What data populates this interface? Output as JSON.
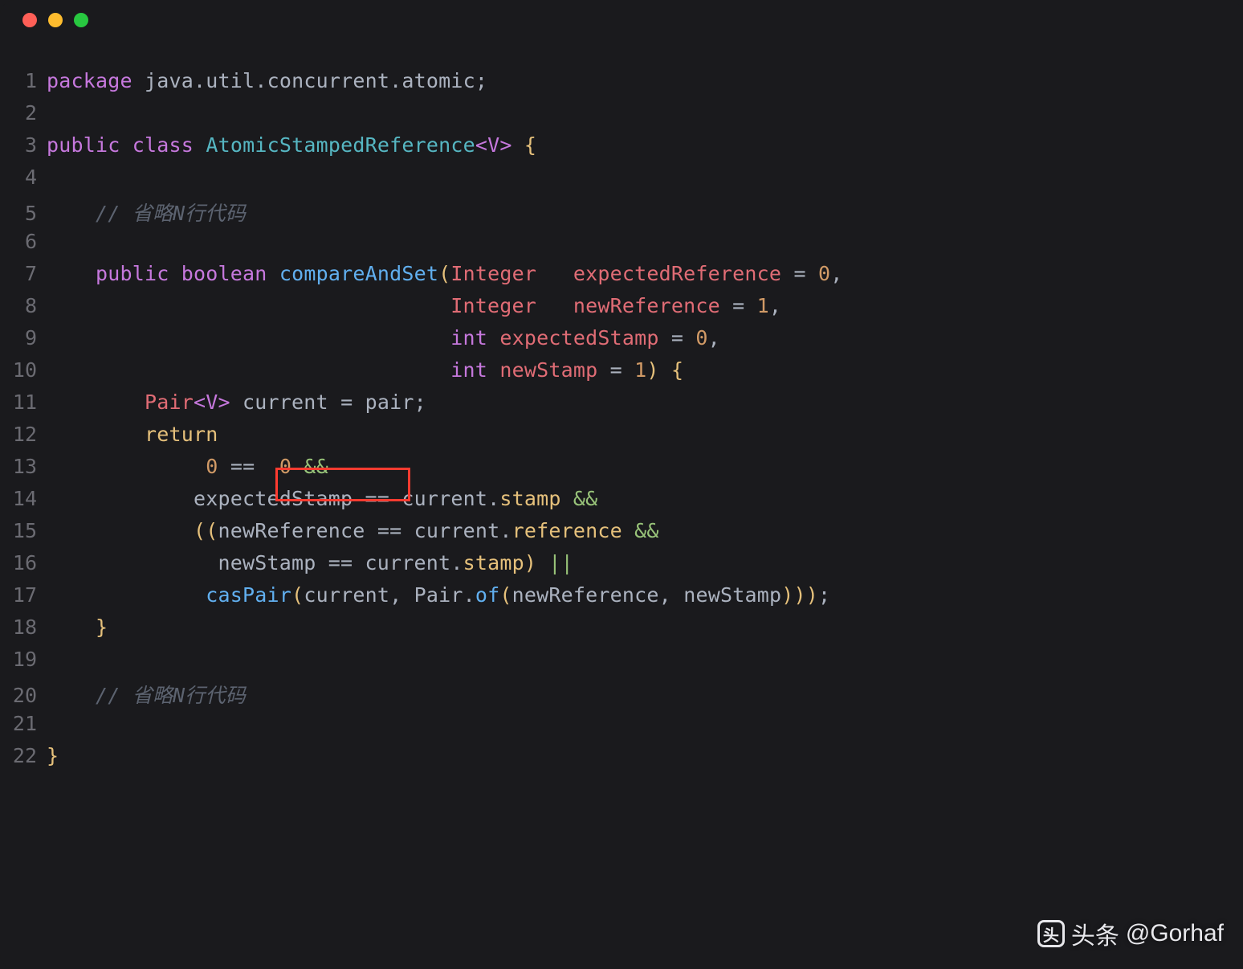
{
  "traffic_lights": {
    "red": "#ff5f57",
    "yellow": "#febc2e",
    "green": "#28c840"
  },
  "highlight": {
    "target": "0 == 0"
  },
  "watermark": {
    "brand": "头条",
    "handle": "@Gorhaf"
  },
  "lines": [
    {
      "n": 1,
      "tokens": [
        [
          "kw",
          "package"
        ],
        [
          "plain",
          " java"
        ],
        [
          "op",
          "."
        ],
        [
          "plain",
          "util"
        ],
        [
          "op",
          "."
        ],
        [
          "plain",
          "concurrent"
        ],
        [
          "op",
          "."
        ],
        [
          "plain",
          "atomic"
        ],
        [
          "op",
          ";"
        ]
      ]
    },
    {
      "n": 2,
      "tokens": []
    },
    {
      "n": 3,
      "tokens": [
        [
          "kw",
          "public"
        ],
        [
          "plain",
          " "
        ],
        [
          "kw",
          "class"
        ],
        [
          "plain",
          " "
        ],
        [
          "classnm",
          "AtomicStampedReference"
        ],
        [
          "generic",
          "<V>"
        ],
        [
          "plain",
          " "
        ],
        [
          "prop",
          "{"
        ]
      ]
    },
    {
      "n": 4,
      "tokens": []
    },
    {
      "n": 5,
      "tokens": [
        [
          "plain",
          "    "
        ],
        [
          "comment",
          "// 省略N行代码"
        ]
      ]
    },
    {
      "n": 6,
      "tokens": []
    },
    {
      "n": 7,
      "tokens": [
        [
          "plain",
          "    "
        ],
        [
          "kw",
          "public"
        ],
        [
          "plain",
          " "
        ],
        [
          "kw",
          "boolean"
        ],
        [
          "plain",
          " "
        ],
        [
          "method",
          "compareAndSet"
        ],
        [
          "prop",
          "("
        ],
        [
          "type",
          "Integer"
        ],
        [
          "plain",
          "   "
        ],
        [
          "param",
          "expectedReference"
        ],
        [
          "plain",
          " "
        ],
        [
          "op",
          "="
        ],
        [
          "plain",
          " "
        ],
        [
          "num",
          "0"
        ],
        [
          "op",
          ","
        ]
      ]
    },
    {
      "n": 8,
      "tokens": [
        [
          "plain",
          "                                 "
        ],
        [
          "type",
          "Integer"
        ],
        [
          "plain",
          "   "
        ],
        [
          "param",
          "newReference"
        ],
        [
          "plain",
          " "
        ],
        [
          "op",
          "="
        ],
        [
          "plain",
          " "
        ],
        [
          "num",
          "1"
        ],
        [
          "op",
          ","
        ]
      ]
    },
    {
      "n": 9,
      "tokens": [
        [
          "plain",
          "                                 "
        ],
        [
          "kw",
          "int"
        ],
        [
          "plain",
          " "
        ],
        [
          "param",
          "expectedStamp"
        ],
        [
          "plain",
          " "
        ],
        [
          "op",
          "="
        ],
        [
          "plain",
          " "
        ],
        [
          "num",
          "0"
        ],
        [
          "op",
          ","
        ]
      ]
    },
    {
      "n": 10,
      "tokens": [
        [
          "plain",
          "                                 "
        ],
        [
          "kw",
          "int"
        ],
        [
          "plain",
          " "
        ],
        [
          "param",
          "newStamp"
        ],
        [
          "plain",
          " "
        ],
        [
          "op",
          "="
        ],
        [
          "plain",
          " "
        ],
        [
          "num",
          "1"
        ],
        [
          "prop",
          ")"
        ],
        [
          "plain",
          " "
        ],
        [
          "prop",
          "{"
        ]
      ]
    },
    {
      "n": 11,
      "tokens": [
        [
          "plain",
          "        "
        ],
        [
          "type",
          "Pair"
        ],
        [
          "generic",
          "<V>"
        ],
        [
          "plain",
          " current "
        ],
        [
          "op",
          "="
        ],
        [
          "plain",
          " pair"
        ],
        [
          "op",
          ";"
        ]
      ]
    },
    {
      "n": 12,
      "tokens": [
        [
          "plain",
          "        "
        ],
        [
          "ret",
          "return"
        ]
      ]
    },
    {
      "n": 13,
      "tokens": [
        [
          "plain",
          "             "
        ],
        [
          "num",
          "0"
        ],
        [
          "plain",
          " "
        ],
        [
          "op",
          "=="
        ],
        [
          "plain",
          "  "
        ],
        [
          "num",
          "0"
        ],
        [
          "plain",
          " "
        ],
        [
          "logic",
          "&&"
        ]
      ]
    },
    {
      "n": 14,
      "tokens": [
        [
          "plain",
          "            expectedStamp "
        ],
        [
          "op",
          "=="
        ],
        [
          "plain",
          " current"
        ],
        [
          "op",
          "."
        ],
        [
          "prop",
          "stamp"
        ],
        [
          "plain",
          " "
        ],
        [
          "logic",
          "&&"
        ]
      ]
    },
    {
      "n": 15,
      "tokens": [
        [
          "plain",
          "            "
        ],
        [
          "prop",
          "(("
        ],
        [
          "plain",
          "newReference "
        ],
        [
          "op",
          "=="
        ],
        [
          "plain",
          " current"
        ],
        [
          "op",
          "."
        ],
        [
          "prop",
          "reference"
        ],
        [
          "plain",
          " "
        ],
        [
          "logic",
          "&&"
        ]
      ]
    },
    {
      "n": 16,
      "tokens": [
        [
          "plain",
          "              newStamp "
        ],
        [
          "op",
          "=="
        ],
        [
          "plain",
          " current"
        ],
        [
          "op",
          "."
        ],
        [
          "prop",
          "stamp"
        ],
        [
          "prop",
          ")"
        ],
        [
          "plain",
          " "
        ],
        [
          "logic",
          "||"
        ]
      ]
    },
    {
      "n": 17,
      "tokens": [
        [
          "plain",
          "             "
        ],
        [
          "call",
          "casPair"
        ],
        [
          "prop",
          "("
        ],
        [
          "plain",
          "current"
        ],
        [
          "op",
          ","
        ],
        [
          "plain",
          " Pair"
        ],
        [
          "op",
          "."
        ],
        [
          "call",
          "of"
        ],
        [
          "prop",
          "("
        ],
        [
          "plain",
          "newReference"
        ],
        [
          "op",
          ","
        ],
        [
          "plain",
          " newStamp"
        ],
        [
          "prop",
          ")))"
        ],
        [
          "op",
          ";"
        ]
      ]
    },
    {
      "n": 18,
      "tokens": [
        [
          "plain",
          "    "
        ],
        [
          "prop",
          "}"
        ]
      ]
    },
    {
      "n": 19,
      "tokens": []
    },
    {
      "n": 20,
      "tokens": [
        [
          "plain",
          "    "
        ],
        [
          "comment",
          "// 省略N行代码"
        ]
      ]
    },
    {
      "n": 21,
      "tokens": []
    },
    {
      "n": 22,
      "tokens": [
        [
          "prop",
          "}"
        ]
      ]
    }
  ]
}
